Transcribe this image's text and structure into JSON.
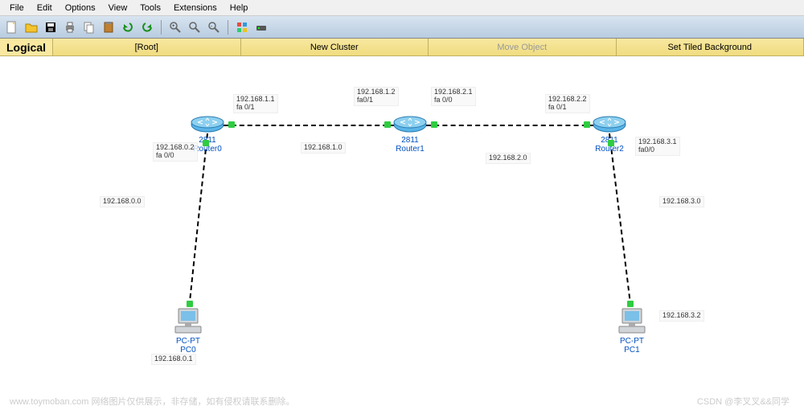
{
  "menu": [
    "File",
    "Edit",
    "Options",
    "View",
    "Tools",
    "Extensions",
    "Help"
  ],
  "secondbar": {
    "logical": "Logical",
    "root": "[Root]",
    "newcluster": "New Cluster",
    "moveobject": "Move Object",
    "tiled": "Set Tiled Background"
  },
  "devices": {
    "router0": {
      "model": "2811",
      "name": "Router0"
    },
    "router1": {
      "model": "2811",
      "name": "Router1"
    },
    "router2": {
      "model": "2811",
      "name": "Router2"
    },
    "pc0": {
      "model": "PC-PT",
      "name": "PC0"
    },
    "pc1": {
      "model": "PC-PT",
      "name": "PC1"
    }
  },
  "labels": {
    "r0_fa01": "192.168.1.1\nfa 0/1",
    "r0_fa00": "192.168.0.2\nfa 0/0",
    "r1_fa01_left": "192.168.1.2\nfa0/1",
    "r1_fa00_right": "192.168.2.1\nfa 0/0",
    "r2_fa01": "192.168.2.2\nfa 0/1",
    "r2_fa00": "192.168.3.1\nfa0/0",
    "net0": "192.168.0.0",
    "net1": "192.168.1.0",
    "net2": "192.168.2.0",
    "net3": "192.168.3.0",
    "pc0_ip": "192.168.0.1",
    "pc1_ip": "192.168.3.2"
  },
  "watermarks": {
    "left": "www.toymoban.com 网络图片仅供展示，非存储，如有侵权请联系删除。",
    "right": "CSDN @李叉叉&&同学"
  }
}
